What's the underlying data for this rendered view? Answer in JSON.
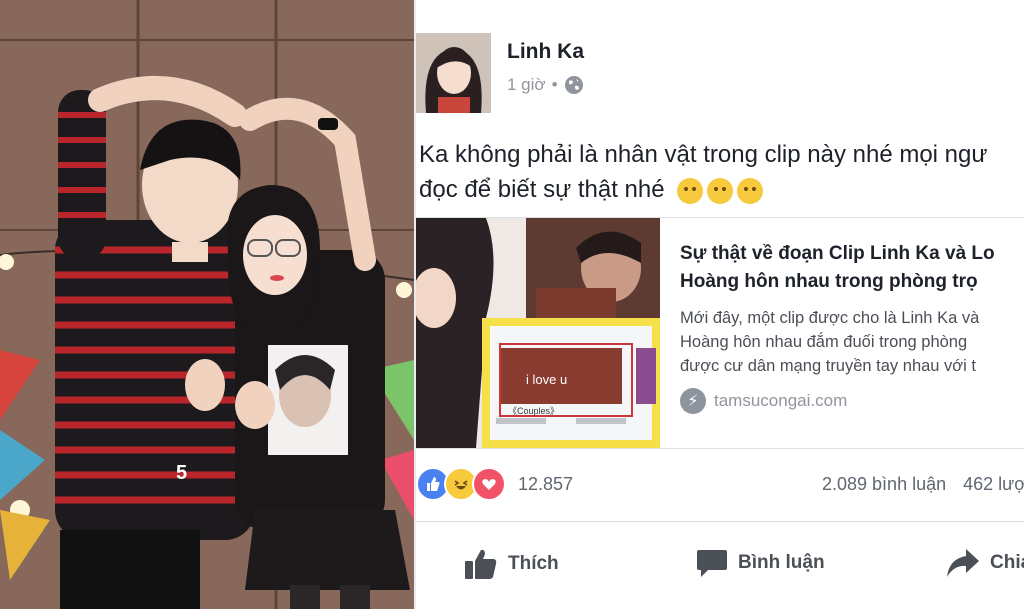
{
  "post": {
    "author": "Linh Ka",
    "time": "1 giờ",
    "privacy_icon": "globe-icon",
    "text_line1": "Ka không phải là nhân vật trong clip này nhé mọi ngư",
    "text_line2": "đọc để biết sự thật nhé",
    "emojis": [
      "hugging-face-icon",
      "hugging-face-icon",
      "hugging-face-icon"
    ]
  },
  "link_preview": {
    "title_line1": "Sự thật về đoạn Clip Linh Ka và Lo",
    "title_line2": "Hoàng hôn nhau trong phòng trọ",
    "desc_line1": "Mới đây, một clip được cho là Linh Ka và",
    "desc_line2": "Hoàng hôn nhau đắm đuối trong phòng",
    "desc_line3": "được cư dân mạng truyền tay nhau với t",
    "domain": "tamsucongai.com",
    "thumb_caption": "i love u",
    "thumb_tag": "《Couples》"
  },
  "stats": {
    "reaction_count": "12.857",
    "comments": "2.089 bình luận",
    "shares": "462 lượ"
  },
  "actions": {
    "like": "Thích",
    "comment": "Bình luận",
    "share": "Chia"
  },
  "photo": {
    "shirt_number": "5"
  },
  "colors": {
    "like_blue": "#4a81f2",
    "love_red": "#f25268",
    "haha_yellow": "#f7c93c",
    "text_primary": "#1d2129",
    "text_secondary": "#90949c"
  }
}
